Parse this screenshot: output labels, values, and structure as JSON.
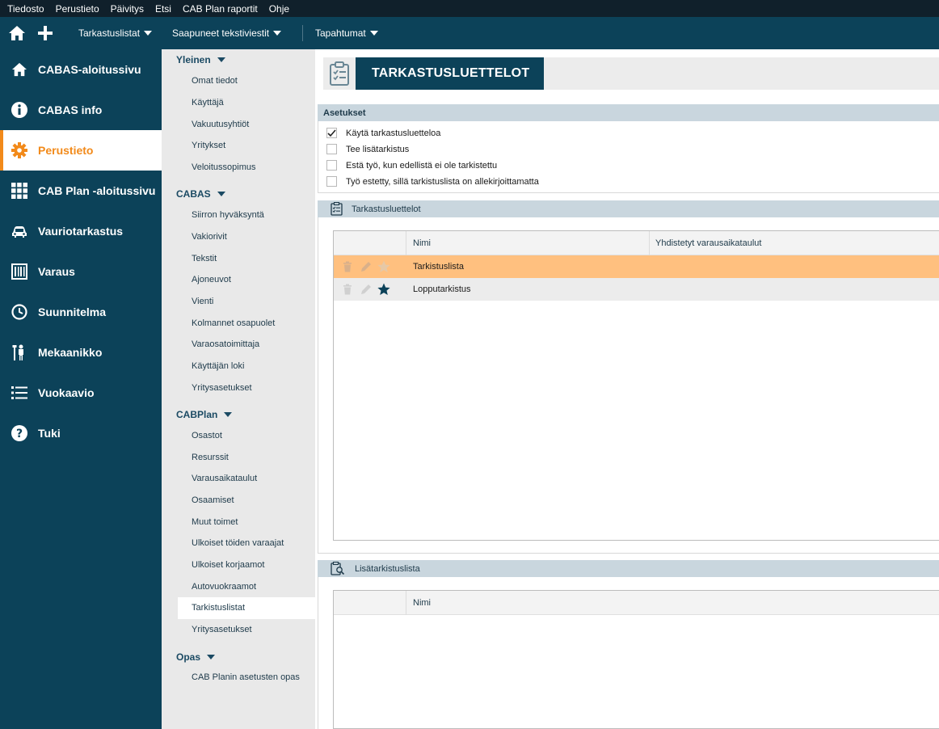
{
  "menubar": [
    "Tiedosto",
    "Perustieto",
    "Päivitys",
    "Etsi",
    "CAB Plan raportit",
    "Ohje"
  ],
  "toolbar": {
    "dropdowns": [
      "Tarkastuslistat",
      "Saapuneet tekstiviestit",
      "Tapahtumat"
    ]
  },
  "leftnav": {
    "items": [
      {
        "label": "CABAS-aloitussivu",
        "icon": "home-icon"
      },
      {
        "label": "CABAS info",
        "icon": "info-icon"
      },
      {
        "label": "Perustieto",
        "icon": "gear-icon",
        "active": true
      },
      {
        "label": "CAB Plan -aloitussivu",
        "icon": "grid-icon"
      },
      {
        "label": "Vauriotarkastus",
        "icon": "car-damage-icon"
      },
      {
        "label": "Varaus",
        "icon": "calendar-icon"
      },
      {
        "label": "Suunnitelma",
        "icon": "clock-icon"
      },
      {
        "label": "Mekaanikko",
        "icon": "mechanic-icon"
      },
      {
        "label": "Vuokaavio",
        "icon": "list-icon"
      },
      {
        "label": "Tuki",
        "icon": "help-icon"
      }
    ]
  },
  "subnav": {
    "sections": [
      {
        "title": "Yleinen",
        "items": [
          "Omat tiedot",
          "Käyttäjä",
          "Vakuutusyhtiöt",
          "Yritykset",
          "Veloitussopimus"
        ]
      },
      {
        "title": "CABAS",
        "items": [
          "Siirron hyväksyntä",
          "Vakiorivit",
          "Tekstit",
          "Ajoneuvot",
          "Vienti",
          "Kolmannet osapuolet",
          "Varaosatoimittaja",
          "Käyttäjän loki",
          "Yritysasetukset"
        ]
      },
      {
        "title": "CABPlan",
        "items": [
          "Osastot",
          "Resurssit",
          "Varausaikataulut",
          "Osaamiset",
          "Muut toimet",
          "Ulkoiset töiden varaajat",
          "Ulkoiset korjaamot",
          "Autovuokraamot",
          "Tarkistuslistat",
          "Yritysasetukset"
        ]
      },
      {
        "title": "Opas",
        "items": [
          "CAB Planin asetusten opas"
        ]
      }
    ],
    "active_item": "Tarkistuslistat"
  },
  "page": {
    "title": "TARKASTUSLUETTELOT",
    "settings_header": "Asetukset",
    "settings": [
      {
        "label": "Käytä tarkastusluetteloa",
        "checked": true
      },
      {
        "label": "Tee lisätarkistus",
        "checked": false
      },
      {
        "label": "Estä työ, kun edellistä ei ole tarkistettu",
        "checked": false
      },
      {
        "label": "Työ estetty, sillä tarkistuslista on allekirjoittamatta",
        "checked": false
      }
    ],
    "lists_header": "Tarkastusluettelot",
    "lists_columns": [
      "Nimi",
      "Yhdistetyt varausaikataulut"
    ],
    "lists_rows": [
      {
        "name": "Tarkistuslista",
        "linked": "",
        "selected": true,
        "default": false
      },
      {
        "name": "Lopputarkistus",
        "linked": "",
        "selected": false,
        "default": true
      }
    ],
    "extra_header": "Lisätarkistuslista",
    "extra_columns": [
      "Nimi"
    ]
  },
  "colors": {
    "nav_bg": "#0c4259",
    "menubar_bg": "#10202b",
    "accent": "#f28a1a",
    "selected_row": "#ffc07f",
    "section_header": "#c9d6de"
  }
}
